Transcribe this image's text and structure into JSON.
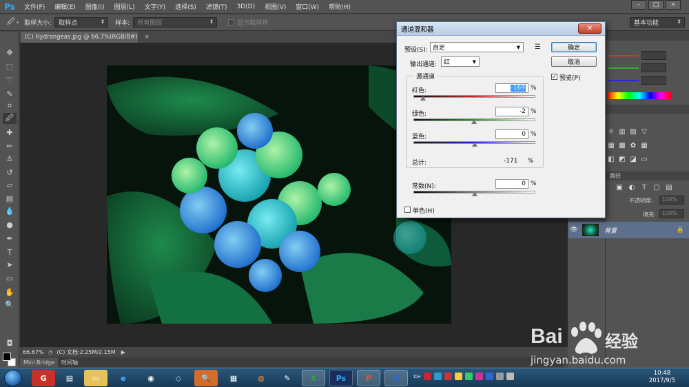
{
  "app": {
    "logo": "Ps"
  },
  "menu": [
    "文件(F)",
    "编辑(E)",
    "图像(I)",
    "图层(L)",
    "文字(Y)",
    "选择(S)",
    "滤镜(T)",
    "3D(D)",
    "视图(V)",
    "窗口(W)",
    "帮助(H)"
  ],
  "window_controls": [
    "–",
    "□",
    "×"
  ],
  "options_bar": {
    "sample_size_label": "取样大小:",
    "sample_size_value": "取样点",
    "sample_label": "样本:",
    "sample_value": "所有图层",
    "show_ring_label": "显示取样环",
    "workspace_value": "基本功能"
  },
  "document": {
    "tab_title": "(C) Hydrangeas.jpg @ 66.7%(RGB/8#)",
    "tab_close": "×",
    "zoom": "66.67%",
    "doc_info": "(C) 文档:2.25M/2.15M"
  },
  "bottom_tabs": [
    "Mini Bridge",
    "时间轴"
  ],
  "dialog": {
    "title": "通道混和器",
    "close": "✕",
    "preset_label": "预设(S):",
    "preset_value": "自定",
    "output_label": "输出通道:",
    "output_value": "红",
    "source_group": "源通道",
    "channels": [
      {
        "label": "红色:",
        "value": "-169",
        "pct": "%",
        "position": 0.077,
        "track_color": "#cc2a2a"
      },
      {
        "label": "绿色:",
        "value": "-2",
        "pct": "%",
        "position": 0.495,
        "track_color": "#2f9a2f"
      },
      {
        "label": "蓝色:",
        "value": "0",
        "pct": "%",
        "position": 0.5,
        "track_color": "#2a2acc"
      }
    ],
    "total_label": "总计:",
    "total_value": "-171",
    "total_pct": "%",
    "constant_label": "常数(N):",
    "constant_value": "0",
    "constant_pct": "%",
    "constant_position": 0.5,
    "mono_label": "单色(H)",
    "ok_label": "确定",
    "cancel_label": "取消",
    "preview_label": "预览(P)",
    "preview_checked": "✓"
  },
  "right_panel": {
    "layers_tab": "路径",
    "opacity_label": "不透明度:",
    "opacity_value": "100%",
    "fill_label": "填充:",
    "fill_value": "100%",
    "layer_name": "背景",
    "color_slider_colors": [
      "#d93232",
      "#2fb32f",
      "#2b2bd6"
    ]
  },
  "taskbar": {
    "clock_time": "10:48",
    "clock_date": "2017/9/5",
    "lang": "CH"
  },
  "watermark": {
    "brand": "Bai",
    "brand_suffix": "经验",
    "url": "jingyan.baidu.com"
  }
}
